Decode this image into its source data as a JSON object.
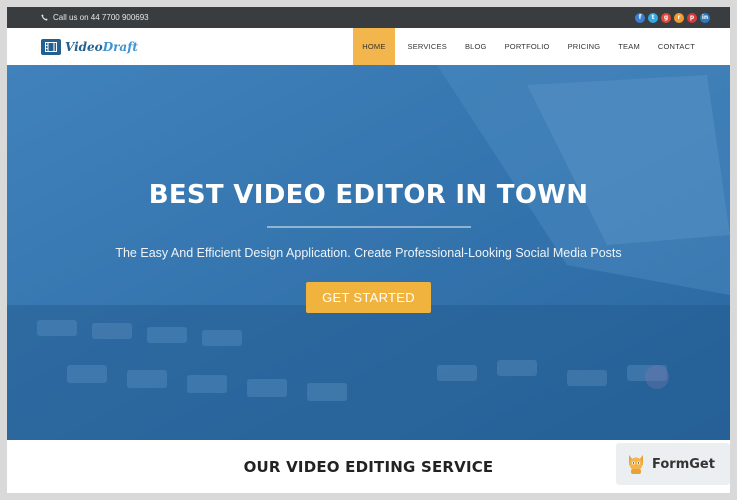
{
  "topbar": {
    "phone": "Call us on 44 7700 900693",
    "socials": [
      {
        "icon": "facebook-icon",
        "glyph": "f",
        "color": "#3b7fd1"
      },
      {
        "icon": "twitter-icon",
        "glyph": "t",
        "color": "#35a7e6"
      },
      {
        "icon": "google-plus-icon",
        "glyph": "g",
        "color": "#e0483a"
      },
      {
        "icon": "rss-icon",
        "glyph": "r",
        "color": "#f29a2e"
      },
      {
        "icon": "pinterest-icon",
        "glyph": "p",
        "color": "#d33a3a"
      },
      {
        "icon": "linkedin-icon",
        "glyph": "in",
        "color": "#2a7ac4"
      }
    ]
  },
  "logo": {
    "text_main": "Video",
    "text_accent": "Draft"
  },
  "nav": {
    "items": [
      "HOME",
      "SERVICES",
      "BLOG",
      "PORTFOLIO",
      "PRICING",
      "TEAM",
      "CONTACT"
    ],
    "active": "HOME"
  },
  "hero": {
    "title": "BEST VIDEO EDITOR IN TOWN",
    "subtitle": "The Easy And Efficient Design Application. Create Professional-Looking Social Media Posts",
    "cta": "GET STARTED"
  },
  "section": {
    "title": "OUR VIDEO EDITING SERVICE"
  },
  "badge": {
    "text": "FormGet"
  },
  "colors": {
    "accent": "#f0b33e",
    "brand": "#24608f",
    "topbar": "#3a3d40",
    "hero": "#2f6ea9"
  }
}
